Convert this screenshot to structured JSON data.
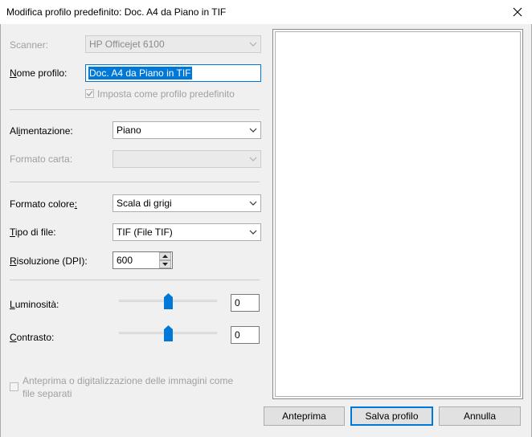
{
  "window": {
    "title": "Modifica profilo predefinito: Doc. A4 da Piano in TIF"
  },
  "form": {
    "scanner": {
      "label": "Scanner:",
      "value": "HP Officejet 6100"
    },
    "profile_name": {
      "label": "Nome profilo:",
      "value": "Doc. A4 da Piano in TIF"
    },
    "default_profile_checkbox": {
      "label": "Imposta come profilo predefinito",
      "checked": true
    },
    "feed": {
      "label": "Alimentazione:",
      "value": "Piano"
    },
    "paper_size": {
      "label": "Formato carta:",
      "value": ""
    },
    "color_format": {
      "label": "Formato colore:",
      "value": "Scala di grigi"
    },
    "file_type": {
      "label": "Tipo di file:",
      "value": "TIF (File TIF)"
    },
    "resolution": {
      "label": "Risoluzione (DPI):",
      "value": "600"
    },
    "brightness": {
      "label": "Luminosità:",
      "value": "0"
    },
    "contrast": {
      "label": "Contrasto:",
      "value": "0"
    },
    "separate_files_checkbox": {
      "label_line1": "Anteprima o digitalizzazione delle immagini come",
      "label_line2": "file separati",
      "checked": false
    }
  },
  "buttons": {
    "preview": "Anteprima",
    "save_profile": "Salva profilo",
    "cancel": "Annulla"
  },
  "colors": {
    "accent": "#0078d7",
    "disabled_text": "#a0a0a0",
    "window_bg": "#f0f0f0"
  }
}
